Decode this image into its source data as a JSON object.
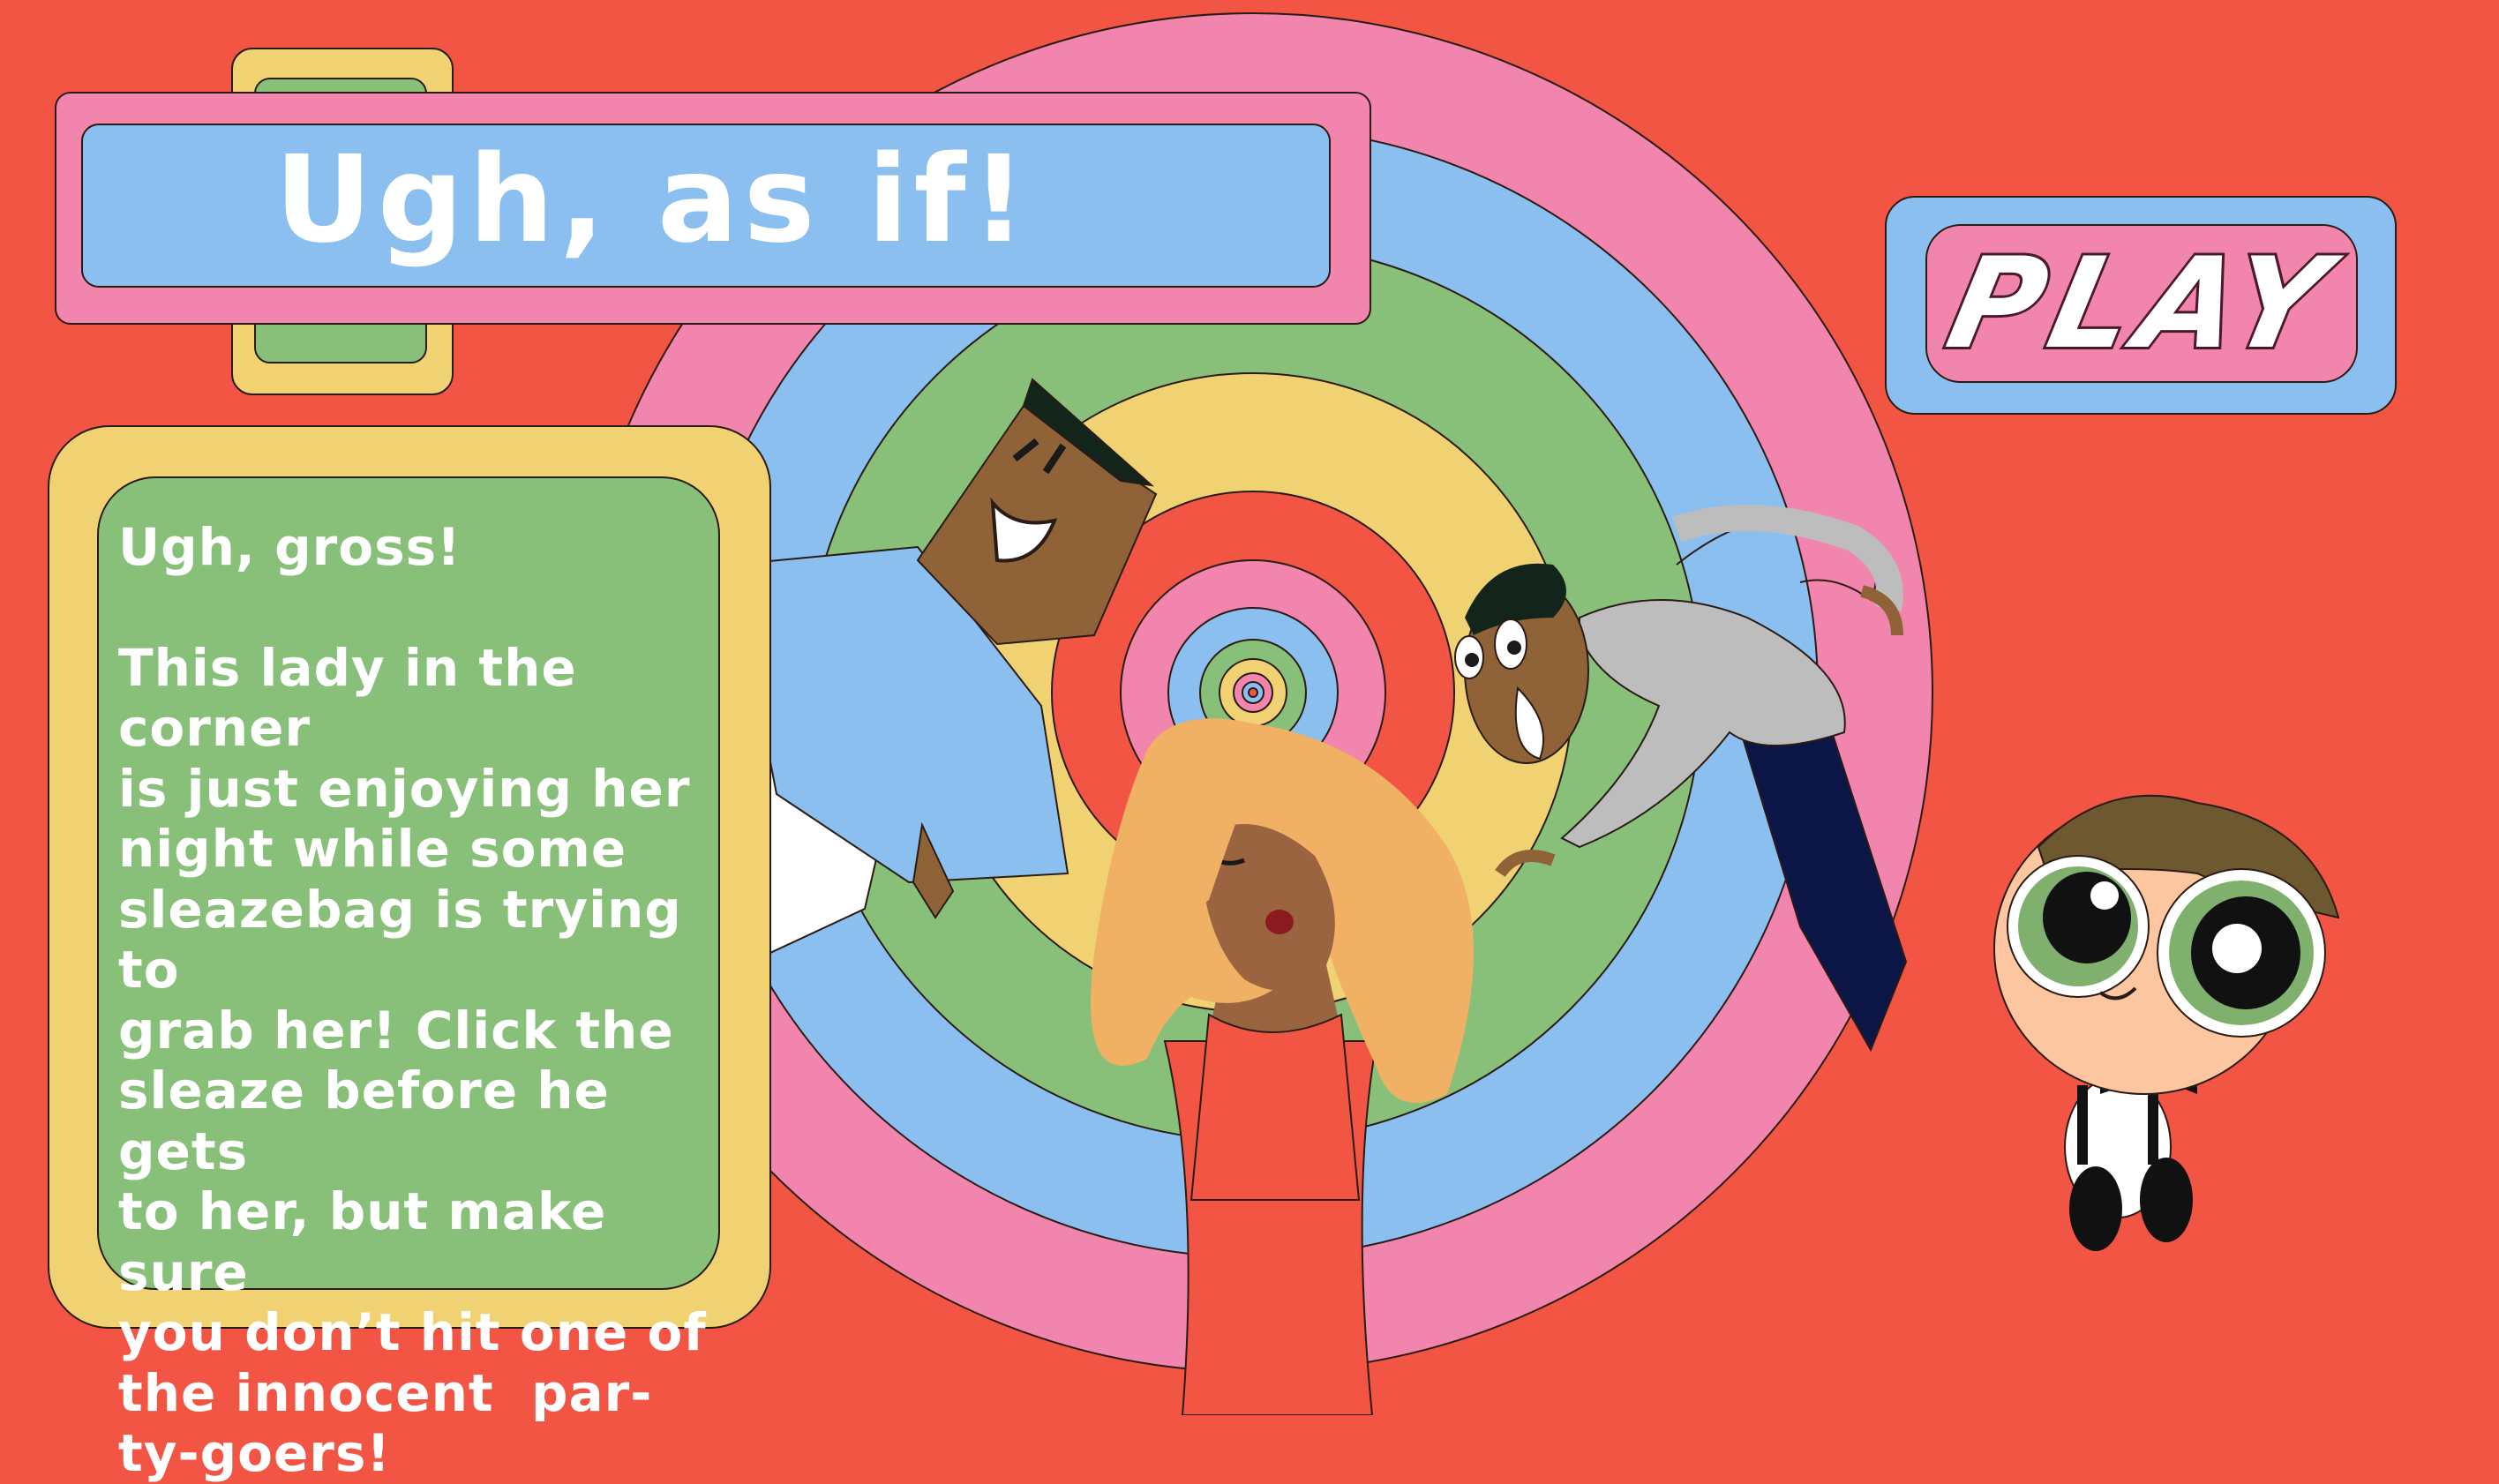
{
  "title": "Ugh, as if!",
  "play_button": {
    "label": "PLAY"
  },
  "instructions": {
    "heading": "Ugh, gross!",
    "lines": [
      "This lady in the corner",
      "is just enjoying her",
      "night while some",
      "sleazebag is trying to",
      "grab her! Click the",
      "sleaze before he gets",
      "to her, but make sure",
      "you don’t hit one of",
      "the innocent  par-",
      "ty-goers!"
    ]
  },
  "characters": [
    "sleaze-guy",
    "lady-in-red",
    "party-goer-grey-shirt",
    "buttercup-boy"
  ],
  "colors": {
    "background": "#f25544",
    "pink": "#f285ae",
    "blue": "#8bbff0",
    "green": "#88c07a",
    "yellow": "#f1d272",
    "white": "#ffffff"
  }
}
